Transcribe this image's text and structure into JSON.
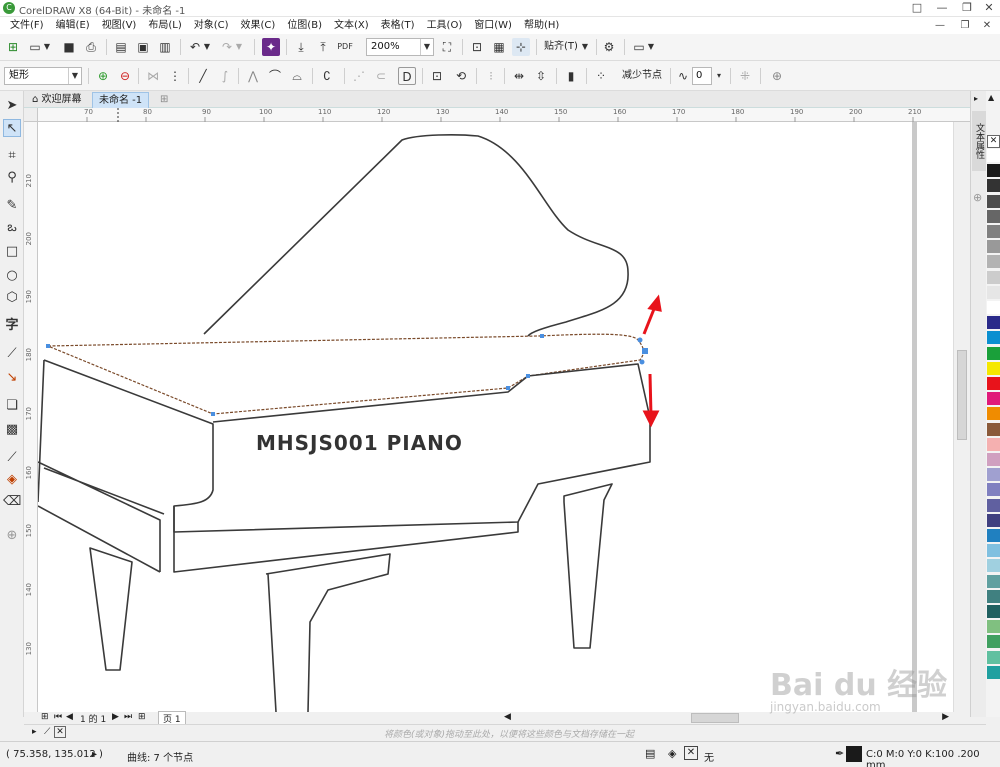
{
  "window": {
    "title": "CorelDRAW X8 (64-Bit) - 未命名 -1",
    "icon": "coreldraw-icon",
    "controls": [
      "□",
      "—",
      "❐",
      "✕"
    ]
  },
  "menu": [
    "文件(F)",
    "编辑(E)",
    "视图(V)",
    "布局(L)",
    "对象(C)",
    "效果(C)",
    "位图(B)",
    "文本(X)",
    "表格(T)",
    "工具(O)",
    "窗口(W)",
    "帮助(H)"
  ],
  "standard_toolbar": {
    "zoom": "200%",
    "snap_label": "贴齐(T)"
  },
  "property_bar": {
    "selection_mode": "矩形",
    "reduce_nodes": "减少节点",
    "curve_smoothness": "0"
  },
  "tabs": {
    "welcome": "欢迎屏幕",
    "document": "未命名 -1"
  },
  "ruler": {
    "h_labels": [
      "70",
      "80",
      "90",
      "100",
      "110",
      "120",
      "130",
      "140",
      "150",
      "160",
      "170",
      "180",
      "190",
      "200",
      "210"
    ],
    "v_labels": [
      "210",
      "200",
      "190",
      "180",
      "170",
      "160",
      "150",
      "140",
      "130"
    ]
  },
  "drawing": {
    "piano_text": "MHSJS001 PIANO",
    "arrow_color": "#e8131b",
    "outline_color": "#3a3a3a",
    "node_color": "#4a8fe0"
  },
  "docker": {
    "tab_label": "文本属性"
  },
  "palette": [
    "#ffffff",
    "#1a1a1a",
    "#333333",
    "#4d4d4d",
    "#666666",
    "#808080",
    "#999999",
    "#b3b3b3",
    "#cccccc",
    "#e6e6e6",
    "#ffffff",
    "#2a2a8a",
    "#0a8fd0",
    "#1aa03a",
    "#f5e800",
    "#e8131b",
    "#e01a7a",
    "#f08c00",
    "#8a5a3a",
    "#f5b0b0",
    "#d0a0c0",
    "#a0a0d0",
    "#8080c0",
    "#6060a0",
    "#404080",
    "#2080c0",
    "#80c0e0",
    "#a0d0e0",
    "#60a0a0",
    "#408080",
    "#206060",
    "#80c080",
    "#40a060",
    "#60c0a0",
    "#20a0a0"
  ],
  "pager": {
    "page_of": "1 的 1",
    "page_tab": "页 1"
  },
  "colorbar_hint": "将颜色(或对象)拖动至此处，以便将这些颜色与文档存储在一起",
  "status": {
    "coords": "( 75.358, 135.012 )",
    "object_info": "曲线: 7 个节点",
    "fill_label": "无",
    "outline_info": "C:0 M:0 Y:0 K:100  .200 mm"
  },
  "watermark": {
    "brand": "Bai du 经验",
    "url": "jingyan.baidu.com"
  }
}
